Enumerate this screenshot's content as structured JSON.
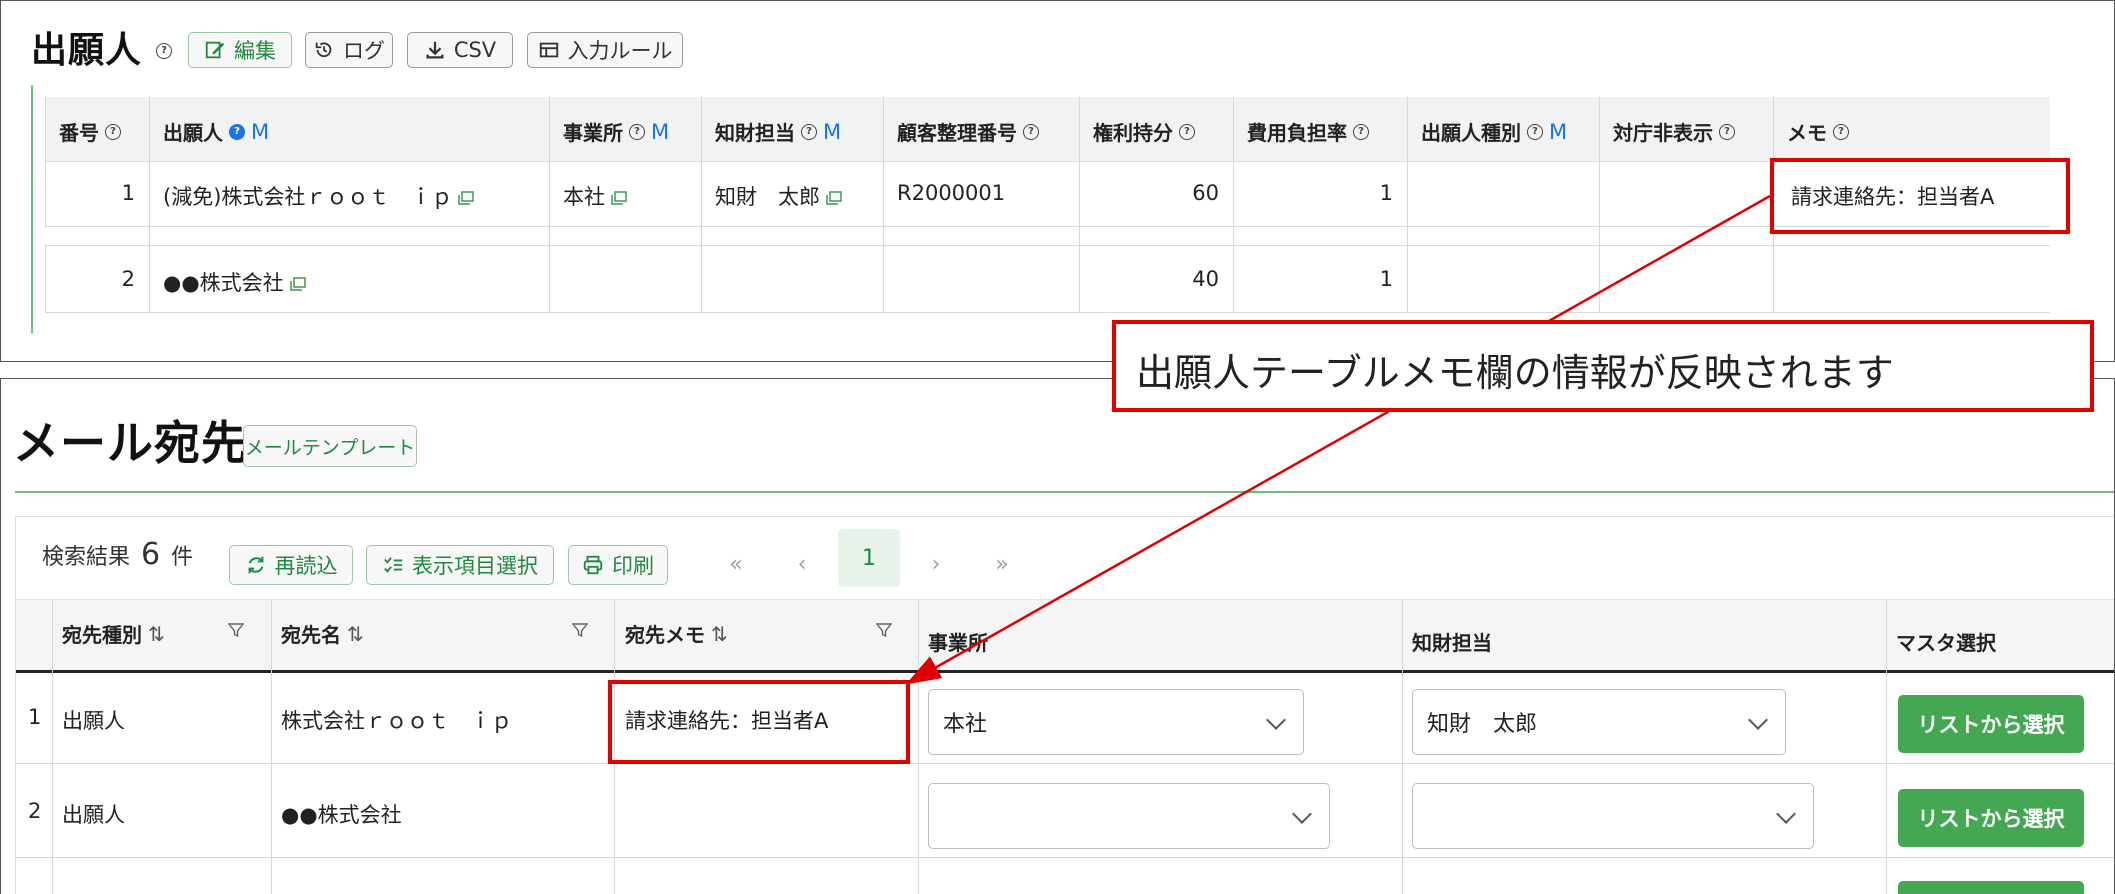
{
  "applicant_panel": {
    "title": "出願人",
    "buttons": {
      "edit": "編集",
      "log": "ログ",
      "csv": "CSV",
      "input_rule": "入力ルール"
    },
    "columns": {
      "number": "番号",
      "applicant": "出願人",
      "office": "事業所",
      "ip_staff": "知財担当",
      "client_ref": "顧客整理番号",
      "share": "権利持分",
      "cost_ratio": "費用負担率",
      "type": "出願人種別",
      "hide": "対庁非表示",
      "memo": "メモ",
      "m": "M"
    },
    "rows": [
      {
        "number": "1",
        "applicant": "(減免)株式会社ｒｏｏｔ　ｉｐ",
        "office": "本社",
        "ip_staff": "知財　太郎",
        "client_ref": "R2000001",
        "share": "60",
        "cost_ratio": "1",
        "type": "",
        "hide": "",
        "memo": "請求連絡先：担当者A"
      },
      {
        "number": "2",
        "applicant": "●●株式会社",
        "office": "",
        "ip_staff": "",
        "client_ref": "",
        "share": "40",
        "cost_ratio": "1",
        "type": "",
        "hide": "",
        "memo": ""
      }
    ]
  },
  "callout": {
    "text": "出願人テーブルメモ欄の情報が反映されます"
  },
  "mail_panel": {
    "title": "メール宛先",
    "template_button": "メールテンプレート",
    "toolbar": {
      "result_label": "検索結果",
      "result_count": "6",
      "result_unit": "件",
      "reload": "再読込",
      "columns_select": "表示項目選択",
      "print": "印刷"
    },
    "pager": {
      "first": "«",
      "prev": "‹",
      "current": "1",
      "next": "›",
      "last": "»"
    },
    "columns": {
      "dest_type": "宛先種別",
      "dest_name": "宛先名",
      "dest_memo": "宛先メモ",
      "office": "事業所",
      "ip_staff": "知財担当",
      "master": "マスタ選択"
    },
    "rows": [
      {
        "index": "1",
        "dest_type": "出願人",
        "dest_name": "株式会社ｒｏｏｔ　ｉｐ",
        "dest_memo": "請求連絡先：担当者A",
        "office": "本社",
        "ip_staff": "知財　太郎",
        "master_button": "リストから選択"
      },
      {
        "index": "2",
        "dest_type": "出願人",
        "dest_name": "●●株式会社",
        "dest_memo": "",
        "office": "",
        "ip_staff": "",
        "master_button": "リストから選択"
      }
    ]
  },
  "colors": {
    "red": "#e00000",
    "green": "#43a851",
    "blue": "#1a73e8"
  }
}
